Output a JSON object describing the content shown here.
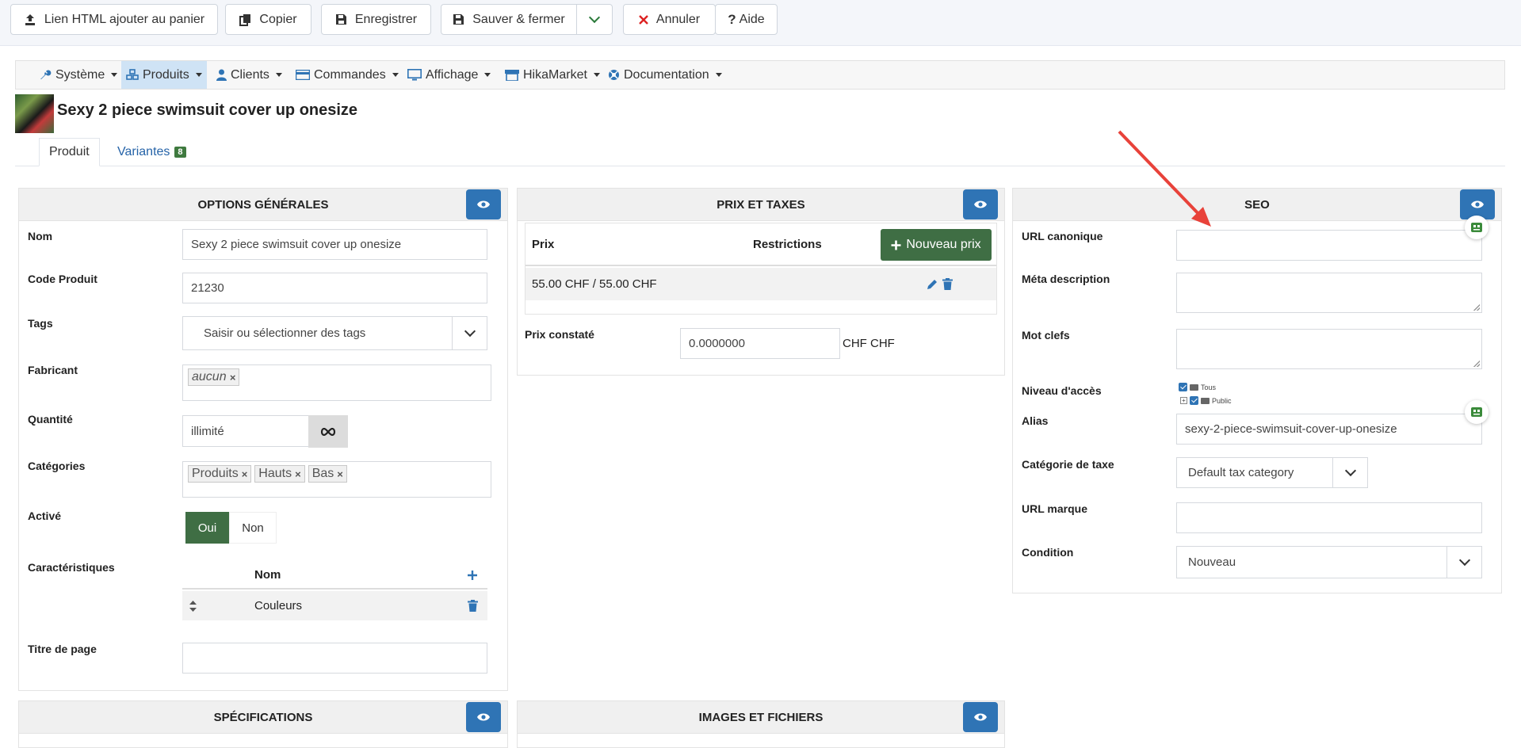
{
  "toolbar": {
    "add_to_cart_html": "Lien HTML ajouter au panier",
    "copy": "Copier",
    "save": "Enregistrer",
    "save_close": "Sauver & fermer",
    "cancel": "Annuler",
    "help": "Aide"
  },
  "menu": {
    "items": [
      {
        "label": "Système",
        "icon": "wrench-icon"
      },
      {
        "label": "Produits",
        "icon": "cubes-icon"
      },
      {
        "label": "Clients",
        "icon": "user-icon"
      },
      {
        "label": "Commandes",
        "icon": "credit-card-icon"
      },
      {
        "label": "Affichage",
        "icon": "monitor-icon"
      },
      {
        "label": "HikaMarket",
        "icon": "shop-icon"
      },
      {
        "label": "Documentation",
        "icon": "lifebuoy-icon"
      }
    ]
  },
  "product": {
    "title": "Sexy 2 piece swimsuit cover up onesize"
  },
  "tabs": {
    "product": "Produit",
    "variants": "Variantes",
    "variants_count": "8"
  },
  "general": {
    "heading": "OPTIONS GÉNÉRALES",
    "name_label": "Nom",
    "name_value": "Sexy 2 piece swimsuit cover up onesize",
    "code_label": "Code Produit",
    "code_value": "21230",
    "tags_label": "Tags",
    "tags_placeholder": "Saisir ou sélectionner des tags",
    "manufacturer_label": "Fabricant",
    "manufacturer_chip": "aucun",
    "quantity_label": "Quantité",
    "quantity_value": "illimité",
    "categories_label": "Catégories",
    "categories": [
      "Produits",
      "Hauts",
      "Bas"
    ],
    "active_label": "Activé",
    "active_yes": "Oui",
    "active_no": "Non",
    "characteristics_label": "Caractéristiques",
    "char_col_name": "Nom",
    "char_row": "Couleurs",
    "page_title_label": "Titre de page"
  },
  "prices": {
    "heading": "PRIX ET TAXES",
    "col_price": "Prix",
    "col_restrictions": "Restrictions",
    "new_price": "Nouveau prix",
    "row_price": "55.00 CHF / 55.00 CHF",
    "observed_label": "Prix constaté",
    "observed_value": "0.0000000",
    "observed_unit": "CHF CHF"
  },
  "seo": {
    "heading": "SEO",
    "canonical_label": "URL canonique",
    "meta_label": "Méta description",
    "keywords_label": "Mot clefs",
    "access_label": "Niveau d'accès",
    "access_all": "Tous",
    "access_public": "Public",
    "alias_label": "Alias",
    "alias_value": "sexy-2-piece-swimsuit-cover-up-onesize",
    "tax_label": "Catégorie de taxe",
    "tax_value": "Default tax category",
    "brand_url_label": "URL marque",
    "condition_label": "Condition",
    "condition_value": "Nouveau"
  },
  "bottom": {
    "specs_heading": "SPÉCIFICATIONS",
    "images_heading": "IMAGES ET FICHIERS"
  },
  "colors": {
    "primary": "#2f74b5",
    "success": "#3f7a3f",
    "annotation_arrow": "#e8423a"
  }
}
